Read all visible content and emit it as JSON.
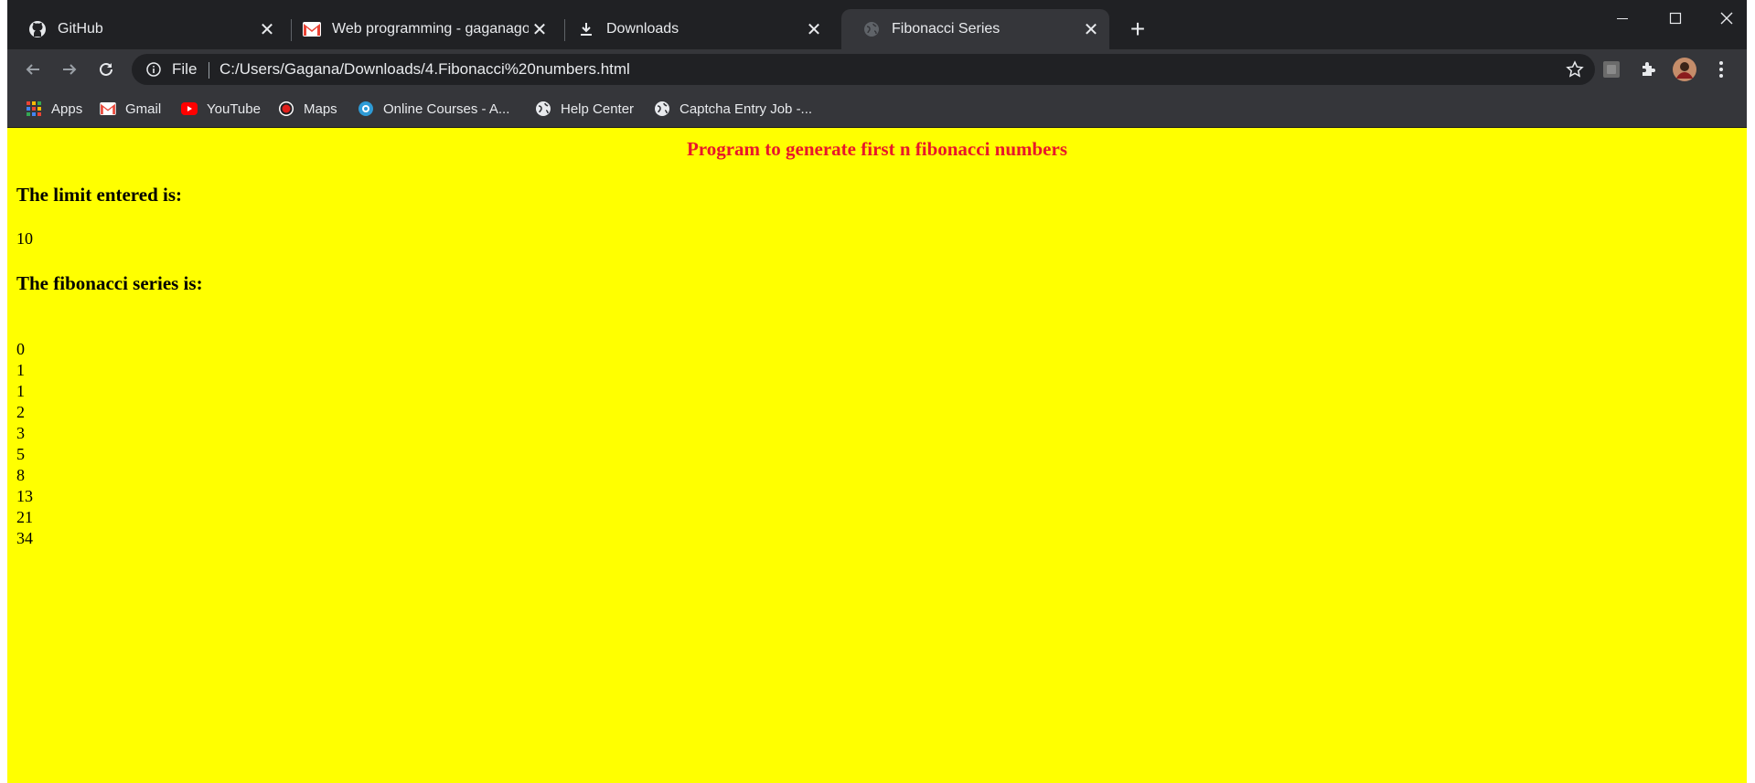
{
  "tabs": [
    {
      "title": "GitHub",
      "icon": "github-icon",
      "active": false
    },
    {
      "title": "Web programming - gaganagowda",
      "icon": "gmail-icon",
      "active": false
    },
    {
      "title": "Downloads",
      "icon": "download-icon",
      "active": false
    },
    {
      "title": "Fibonacci Series",
      "icon": "globe-icon",
      "active": true
    }
  ],
  "omnibox": {
    "scheme_label": "File",
    "url": "C:/Users/Gagana/Downloads/4.Fibonacci%20numbers.html"
  },
  "bookmarks": [
    {
      "label": "Apps",
      "icon": "apps-grid-icon"
    },
    {
      "label": "Gmail",
      "icon": "gmail-icon"
    },
    {
      "label": "YouTube",
      "icon": "youtube-icon"
    },
    {
      "label": "Maps",
      "icon": "maps-icon"
    },
    {
      "label": "Online Courses - A...",
      "icon": "online-courses-icon"
    },
    {
      "label": "Help Center",
      "icon": "globe-icon"
    },
    {
      "label": "Captcha Entry Job -...",
      "icon": "globe-icon"
    }
  ],
  "page": {
    "heading": "Program to generate first n fibonacci numbers",
    "limit_heading": "The limit entered is:",
    "limit_value": "10",
    "series_heading": "The fibonacci series is:",
    "series": [
      "0",
      "1",
      "1",
      "2",
      "3",
      "5",
      "8",
      "13",
      "21",
      "34"
    ]
  },
  "colors": {
    "page_background": "#ffff00",
    "heading_color": "#e8172a",
    "chrome_dark": "#202124",
    "chrome_toolbar": "#35363a"
  }
}
